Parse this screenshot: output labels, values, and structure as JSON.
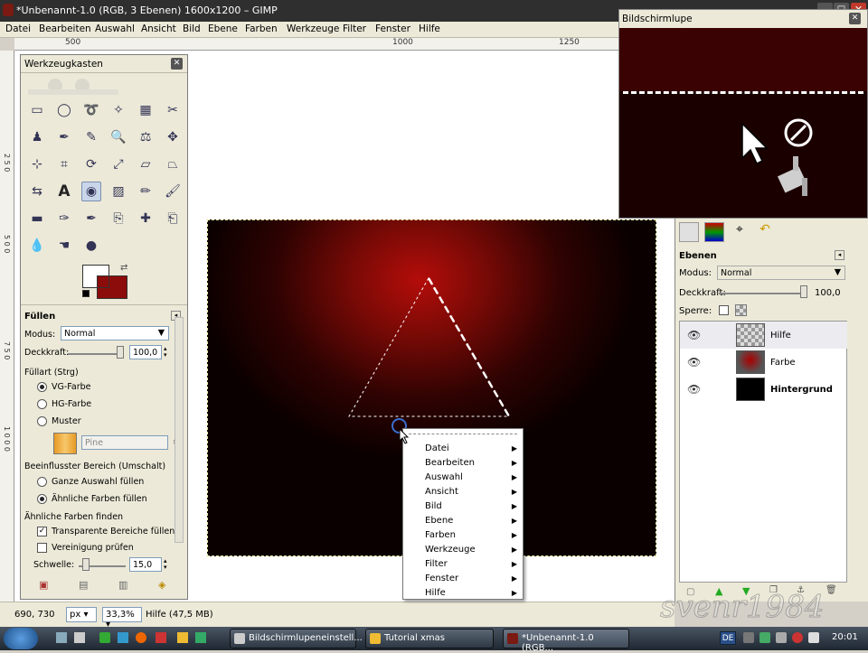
{
  "window": {
    "title": "*Unbenannt-1.0 (RGB, 3 Ebenen) 1600x1200 – GIMP"
  },
  "menubar": [
    "Datei",
    "Bearbeiten",
    "Auswahl",
    "Ansicht",
    "Bild",
    "Ebene",
    "Farben",
    "Werkzeuge",
    "Filter",
    "Fenster",
    "Hilfe"
  ],
  "rulers": {
    "top": [
      "500",
      "1000",
      "1250"
    ],
    "left": [
      "2 5 0",
      "5 0 0",
      "7 5 0",
      "1 0 0 0"
    ]
  },
  "toolbox": {
    "title": "Werkzeugkasten",
    "tools": [
      "rect-select",
      "ellipse-select",
      "free-select",
      "fuzzy-select",
      "color-select",
      "scissors",
      "foreground-select",
      "paths",
      "color-picker",
      "zoom",
      "measure",
      "move",
      "align",
      "crop",
      "rotate",
      "scale",
      "shear",
      "perspective",
      "flip",
      "text",
      "bucket-fill",
      "blend",
      "pencil",
      "paintbrush",
      "eraser",
      "airbrush",
      "ink",
      "clone",
      "heal",
      "perspective-clone",
      "blur",
      "smudge",
      "dodge-burn"
    ],
    "colors": {
      "fg": "#ffffff",
      "bg": "#8b0c0a"
    }
  },
  "fill_options": {
    "title": "Füllen",
    "modus_label": "Modus:",
    "modus_value": "Normal",
    "deckkraft_label": "Deckkraft:",
    "deckkraft_value": "100,0",
    "fuellart_label": "Füllart  (Strg)",
    "fuellart_options": [
      "VG-Farbe",
      "HG-Farbe",
      "Muster"
    ],
    "fuellart_selected": 0,
    "pattern_name": "Pine",
    "bereich_label": "Beeinflusster Bereich (Umschalt)",
    "bereich_options": [
      "Ganze Auswahl füllen",
      "Ähnliche Farben füllen"
    ],
    "bereich_selected": 1,
    "aehnliche_label": "Ähnliche Farben finden",
    "check_transparent": "Transparente Bereiche füllen",
    "check_vereinigung": "Vereinigung prüfen",
    "schwelle_label": "Schwelle:",
    "schwelle_value": "15,0"
  },
  "magnifier": {
    "title": "Bildschirmlupe"
  },
  "layers_panel": {
    "title": "Ebenen",
    "modus_label": "Modus:",
    "modus_value": "Normal",
    "deckkraft_label": "Deckkraft:",
    "deckkraft_value": "100,0",
    "sperre_label": "Sperre:",
    "layers": [
      {
        "name": "Hilfe"
      },
      {
        "name": "Farbe"
      },
      {
        "name": "Hintergrund"
      }
    ]
  },
  "context_menu": [
    "Datei",
    "Bearbeiten",
    "Auswahl",
    "Ansicht",
    "Bild",
    "Ebene",
    "Farben",
    "Werkzeuge",
    "Filter",
    "Fenster",
    "Hilfe"
  ],
  "statusbar": {
    "coords": "690, 730",
    "unit": "px",
    "zoom": "33,3%",
    "info": "Hilfe (47,5 MB)"
  },
  "taskbar": {
    "tasks": [
      "Bildschirmlupeneinstell...",
      "Tutorial xmas",
      "*Unbenannt-1.0 (RGB..."
    ],
    "lang": "DE",
    "clock": "20:01"
  },
  "watermark": "svenr1984"
}
